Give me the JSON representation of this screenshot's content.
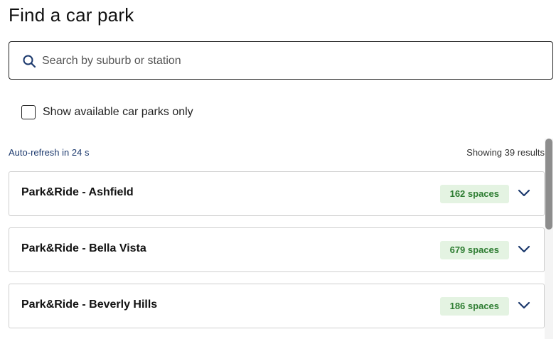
{
  "page": {
    "title": "Find a car park"
  },
  "search": {
    "placeholder": "Search by suburb or station",
    "value": "",
    "icon": "search-icon"
  },
  "filter": {
    "label": "Show available car parks only",
    "checked": false
  },
  "status": {
    "refresh_text": "Auto-refresh in 24 s",
    "results_text": "Showing 39 results"
  },
  "car_parks": [
    {
      "name": "Park&Ride - Ashfield",
      "spaces": "162 spaces"
    },
    {
      "name": "Park&Ride - Bella Vista",
      "spaces": "679 spaces"
    },
    {
      "name": "Park&Ride - Beverly Hills",
      "spaces": "186 spaces"
    }
  ],
  "colors": {
    "accent_text": "#1d3a6e",
    "badge_bg": "#e4f3e2",
    "badge_text": "#2e7d32",
    "icon": "#1d3a6e"
  }
}
